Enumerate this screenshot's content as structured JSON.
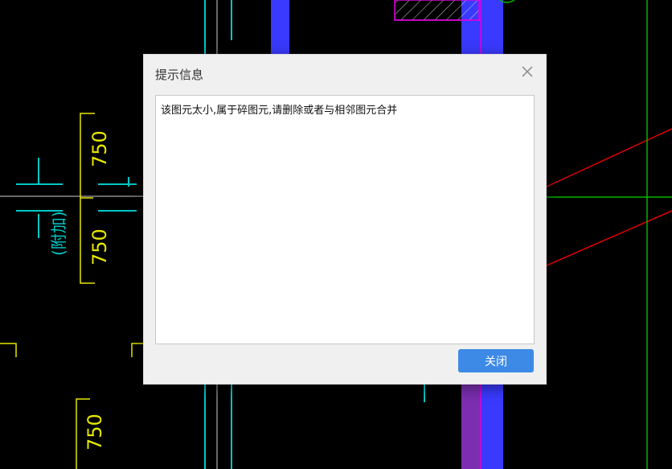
{
  "dialog": {
    "title": "提示信息",
    "message": "该图元太小,属于碎图元,请删除或者与相邻图元合并",
    "close_button_label": "关闭"
  },
  "drawing": {
    "dimension_labels": [
      "750",
      "750",
      "750"
    ],
    "axis_label": "(附加)"
  },
  "colors": {
    "background": "#000000",
    "dimension": "#e8e800",
    "axis": "#00c8c8",
    "column_blue": "#3a3aff",
    "column_purple": "#7b2fb0",
    "hatch_outline": "#e000e0",
    "red_line": "#e00000",
    "green_line": "#00b400",
    "dialog_button": "#3d8ae6"
  }
}
